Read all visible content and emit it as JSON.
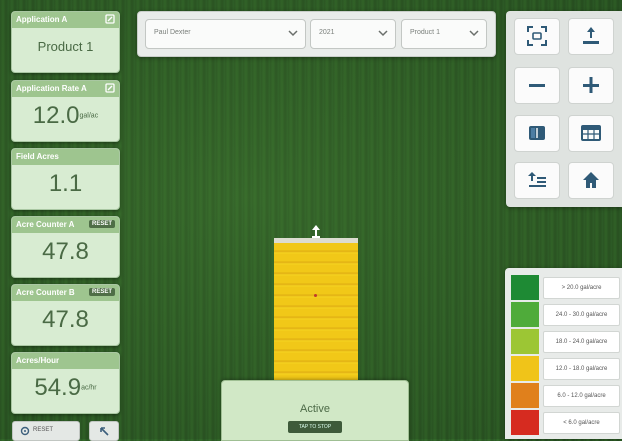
{
  "left_panels": [
    {
      "label": "Application A",
      "value": "Product 1",
      "unit": "",
      "badge": "",
      "edit": true
    },
    {
      "label": "Application Rate A",
      "value": "12.0",
      "unit": "gal/ac",
      "badge": "",
      "edit": true
    },
    {
      "label": "Field Acres",
      "value": "1.1",
      "unit": "",
      "badge": "",
      "edit": false
    },
    {
      "label": "Acre Counter A",
      "value": "47.8",
      "unit": "",
      "badge": "RESET",
      "edit": false
    },
    {
      "label": "Acre Counter B",
      "value": "47.8",
      "unit": "",
      "badge": "RESET",
      "edit": false
    },
    {
      "label": "Acres/Hour",
      "value": "54.9",
      "unit": "ac/hr",
      "badge": "",
      "edit": false
    }
  ],
  "dropdowns": [
    {
      "value": "Paul Dexter"
    },
    {
      "value": "2021"
    },
    {
      "value": "Product 1"
    }
  ],
  "tools": [
    {
      "name": "fullscreen-icon"
    },
    {
      "name": "vehicle-upload-icon"
    },
    {
      "name": "zoom-out-icon"
    },
    {
      "name": "zoom-in-icon"
    },
    {
      "name": "split-view-icon"
    },
    {
      "name": "table-icon"
    },
    {
      "name": "layer-list-icon"
    },
    {
      "name": "home-icon"
    }
  ],
  "legend": [
    {
      "color": "#1e8a34",
      "label": "> 20.0 gal/acre"
    },
    {
      "color": "#4fab3a",
      "label": "24.0 - 30.0 gal/acre"
    },
    {
      "color": "#9cc634",
      "label": "18.0 - 24.0 gal/acre"
    },
    {
      "color": "#f0c419",
      "label": "12.0 - 18.0 gal/acre"
    },
    {
      "color": "#e0801c",
      "label": "6.0 - 12.0 gal/acre"
    },
    {
      "color": "#d62b20",
      "label": "< 6.0 gal/acre"
    }
  ],
  "status": {
    "active_label": "Active",
    "tap_button": "TAP TO STOP"
  },
  "bottom": {
    "reset_label": "RESET"
  },
  "colors": {
    "panel_header": "#9ec58f",
    "panel_bg": "#d8ecd2",
    "coverage": "#f1c818"
  }
}
